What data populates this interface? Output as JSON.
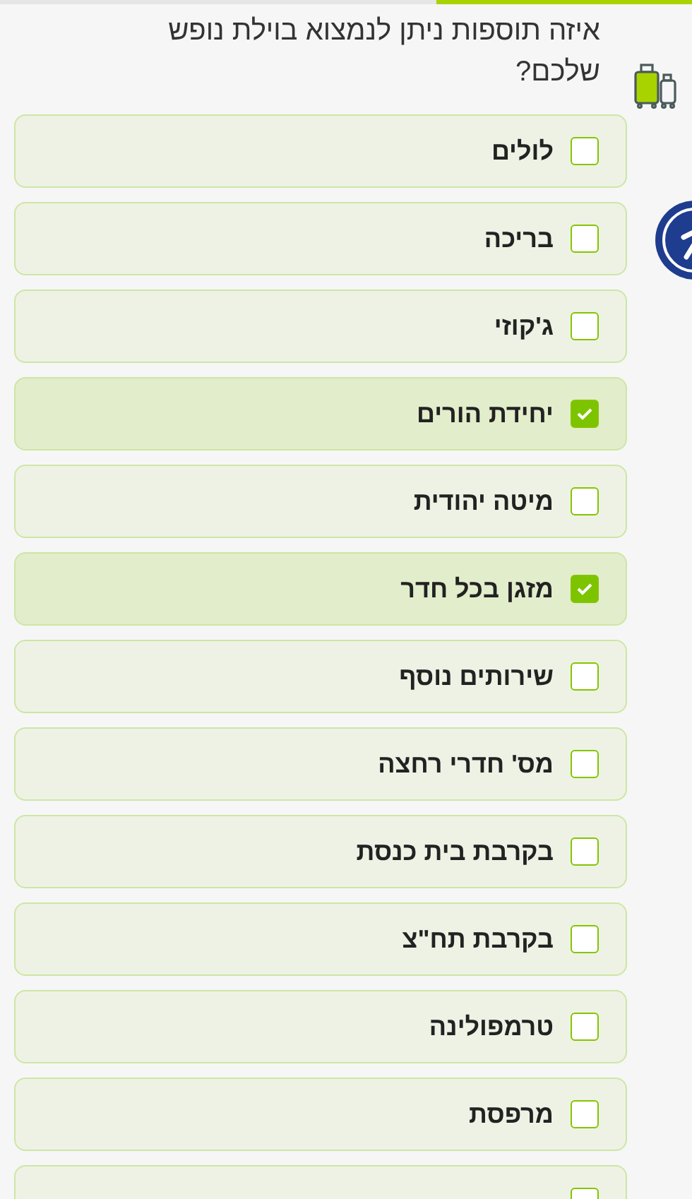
{
  "progress": {
    "level": 0.37
  },
  "question": "איזה תוספות ניתן לנמצוא בוילת נופש שלכם?",
  "options": [
    {
      "label": "לולים",
      "checked": false
    },
    {
      "label": "בריכה",
      "checked": false
    },
    {
      "label": "ג'קוזי",
      "checked": false
    },
    {
      "label": "יחידת הורים",
      "checked": true
    },
    {
      "label": "מיטה יהודית",
      "checked": false
    },
    {
      "label": "מזגן בכל חדר",
      "checked": true
    },
    {
      "label": "שירותים נוסף",
      "checked": false
    },
    {
      "label": "מס' חדרי רחצה",
      "checked": false
    },
    {
      "label": "בקרבת בית כנסת",
      "checked": false
    },
    {
      "label": "בקרבת תח\"צ",
      "checked": false
    },
    {
      "label": "טרמפולינה",
      "checked": false
    },
    {
      "label": "מרפסת",
      "checked": false
    },
    {
      "checked": false
    }
  ]
}
